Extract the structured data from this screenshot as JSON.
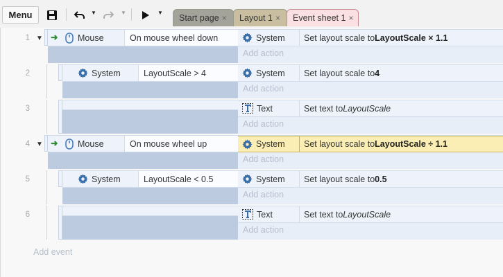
{
  "toolbar": {
    "menu_label": "Menu",
    "tabs": [
      {
        "label": "Start page",
        "close": "×"
      },
      {
        "label": "Layout 1",
        "close": "×"
      },
      {
        "label": "Event sheet 1",
        "close": "×"
      }
    ]
  },
  "events": [
    {
      "number": "1",
      "condition": {
        "object": "Mouse",
        "icon": "mouse-icon",
        "text": "On mouse wheel down"
      },
      "action": {
        "object": "System",
        "icon": "gear-icon",
        "text_prefix": "Set layout scale to ",
        "text_bold": "LayoutScale × 1.1"
      },
      "add_action": "Add action"
    },
    {
      "number": "2",
      "condition": {
        "object": "System",
        "icon": "gear-icon",
        "text": "LayoutScale > 4"
      },
      "action": {
        "object": "System",
        "icon": "gear-icon",
        "text_prefix": "Set layout scale to ",
        "text_bold": "4"
      },
      "add_action": "Add action"
    },
    {
      "number": "3",
      "action": {
        "object": "Text",
        "icon": "text-object-icon",
        "text_prefix": "Set text to ",
        "text_italic": "LayoutScale"
      },
      "add_action": "Add action"
    },
    {
      "number": "4",
      "condition": {
        "object": "Mouse",
        "icon": "mouse-icon",
        "text": "On mouse wheel up"
      },
      "action": {
        "object": "System",
        "icon": "gear-icon",
        "text_prefix": "Set layout scale to ",
        "text_bold": "LayoutScale ÷ 1.1"
      },
      "add_action": "Add action"
    },
    {
      "number": "5",
      "condition": {
        "object": "System",
        "icon": "gear-icon",
        "text": "LayoutScale < 0.5"
      },
      "action": {
        "object": "System",
        "icon": "gear-icon",
        "text_prefix": "Set layout scale to ",
        "text_bold": "0.5"
      },
      "add_action": "Add action"
    },
    {
      "number": "6",
      "action": {
        "object": "Text",
        "icon": "text-object-icon",
        "text_prefix": "Set text to ",
        "text_italic": "LayoutScale"
      },
      "add_action": "Add action"
    }
  ],
  "add_event": "Add event",
  "colors": {
    "highlight": "#fbeeb4",
    "condition_bg": "#bccbe0",
    "action_bg": "#e8eef8",
    "trigger_arrow": "#2f8a35"
  }
}
